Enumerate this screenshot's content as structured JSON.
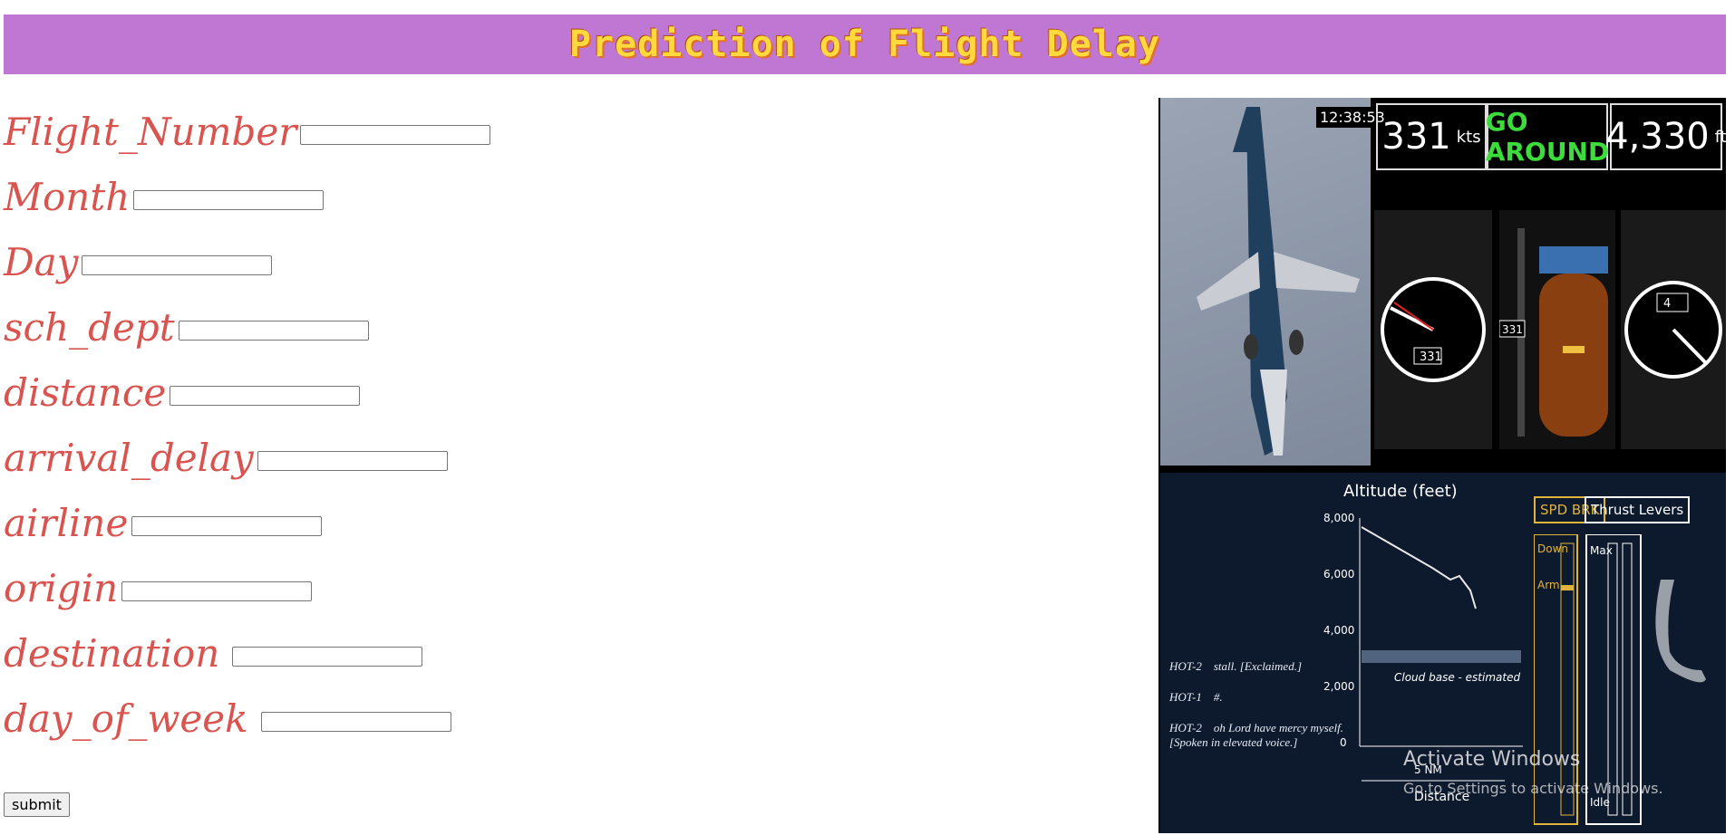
{
  "header": {
    "title": "Prediction of Flight Delay",
    "bg_color": "#c077d4"
  },
  "form": {
    "fields": [
      {
        "label": "Flight_Number",
        "value": ""
      },
      {
        "label": "Month",
        "value": ""
      },
      {
        "label": "Day",
        "value": ""
      },
      {
        "label": "sch_dept",
        "value": ""
      },
      {
        "label": "distance",
        "value": ""
      },
      {
        "label": "arrival_delay",
        "value": ""
      },
      {
        "label": "airline",
        "value": ""
      },
      {
        "label": "origin",
        "value": ""
      },
      {
        "label": "destination",
        "value": ""
      },
      {
        "label": "day_of_week",
        "value": ""
      }
    ],
    "submit_label": "submit"
  },
  "panel": {
    "clock": "12:38:53",
    "speed": {
      "value": "331",
      "unit": "kts"
    },
    "status": "GO AROUND",
    "altitude": {
      "value": "4,330",
      "unit": "ft"
    },
    "airspeed_indicator": "331",
    "altimeter_window": "4",
    "tape_readout": "331",
    "chart_title": "Altitude (feet)",
    "chart_yticks": [
      "8,000",
      "6,000",
      "4,000",
      "2,000",
      "0"
    ],
    "chart_xlabel": "Distance",
    "chart_xtick": "5 NM",
    "cloud_label": "Cloud base - estimated",
    "transcript": [
      {
        "speaker": "HOT-2",
        "text": "stall. [Exclaimed.]"
      },
      {
        "speaker": "HOT-1",
        "text": "#."
      },
      {
        "speaker": "HOT-2",
        "text": "oh Lord have mercy myself.\n[Spoken in elevated voice.]"
      }
    ],
    "spd_brk_label": "SPD BRK",
    "thrust_label": "Thrust Levers",
    "spd_labels": [
      "Down",
      "Arm"
    ],
    "thrust_labels": [
      "Max",
      "Idle"
    ]
  },
  "watermark": {
    "line1": "Activate Windows",
    "line2": "Go to Settings to activate Windows."
  }
}
